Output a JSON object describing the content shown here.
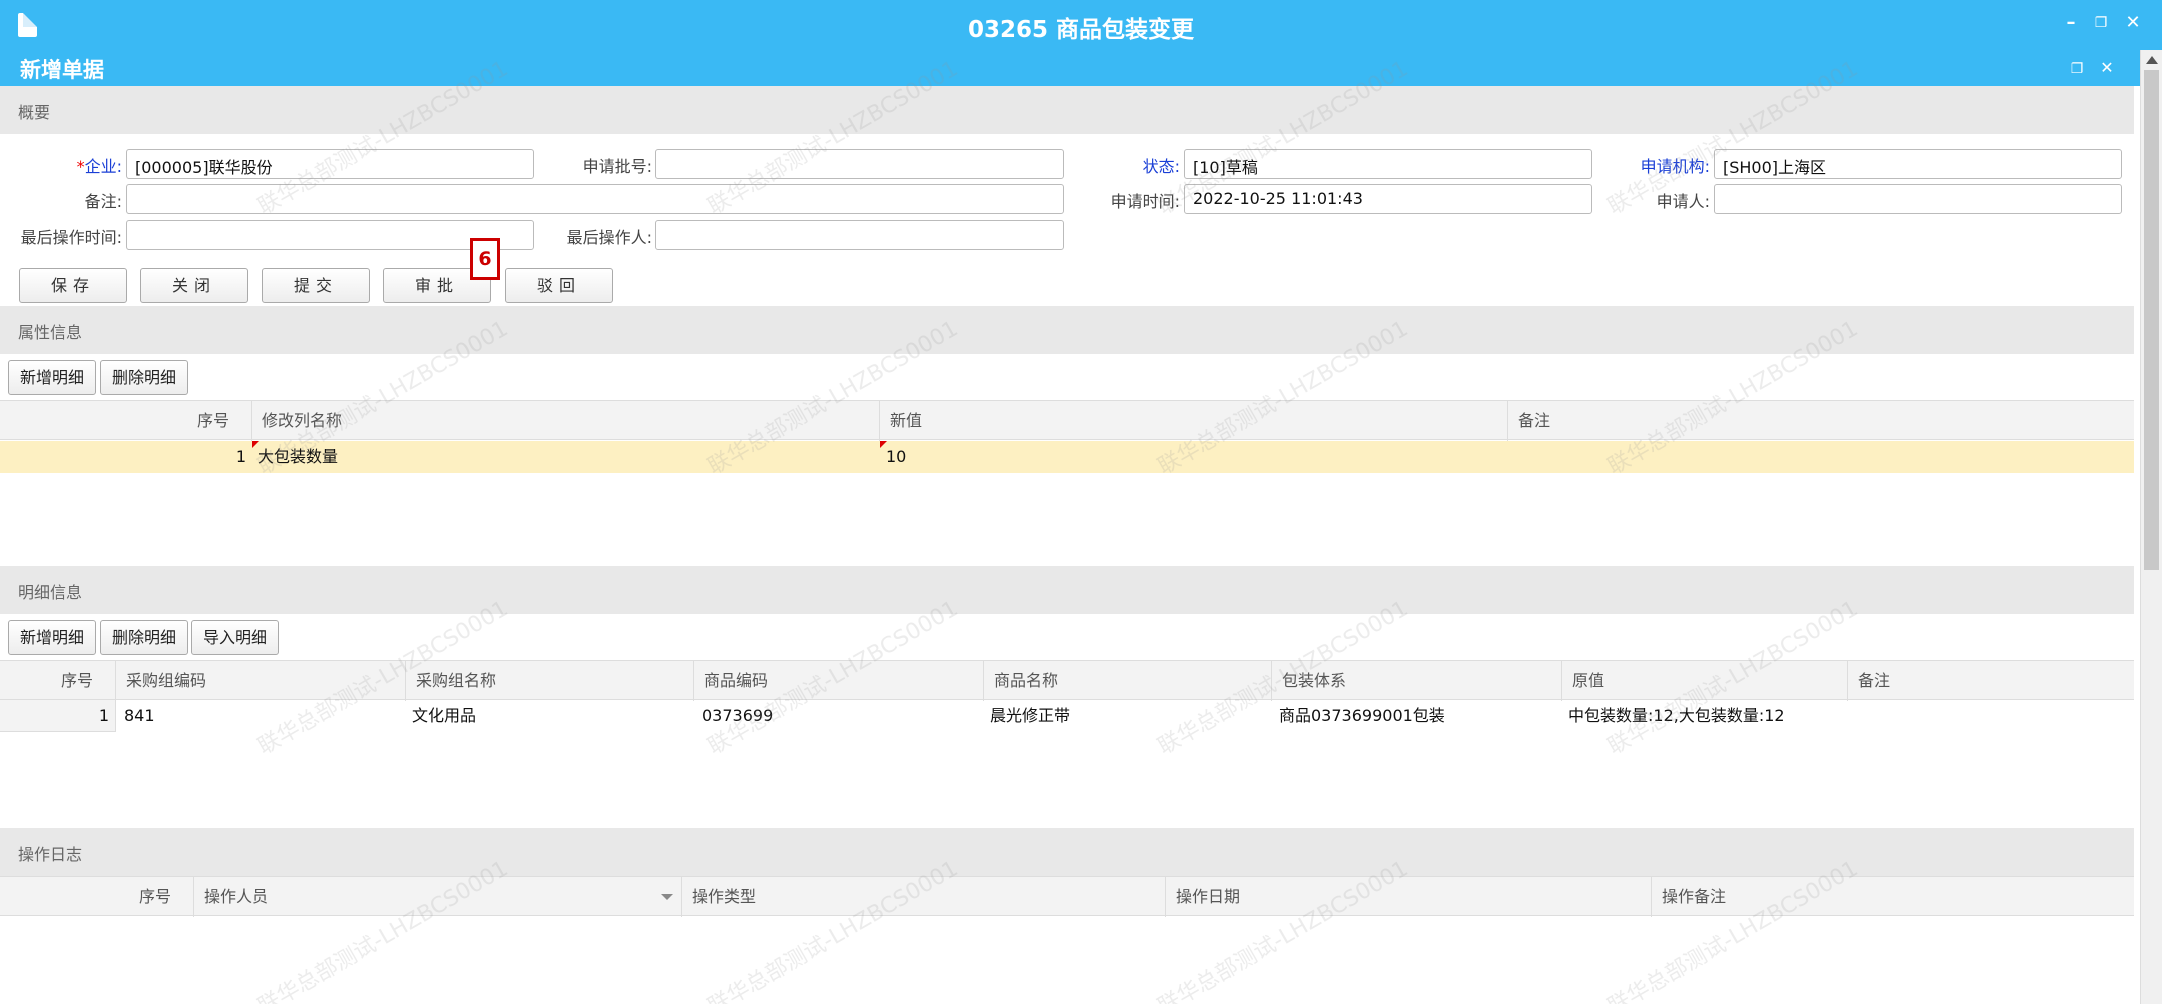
{
  "window": {
    "title": "03265 商品包装变更"
  },
  "subwindow": {
    "title": "新增单据"
  },
  "sections": {
    "summary": "概要",
    "attributes": "属性信息",
    "details": "明细信息",
    "log": "操作日志"
  },
  "form": {
    "company_label": "企业:",
    "company_required": "*",
    "company_value": "[000005]联华股份",
    "batch_label": "申请批号:",
    "batch_value": "",
    "status_label": "状态:",
    "status_value": "[10]草稿",
    "org_label": "申请机构:",
    "org_value": "[SH00]上海区",
    "remark_label": "备注:",
    "remark_value": "",
    "apply_time_label": "申请时间:",
    "apply_time_value": "2022-10-25 11:01:43",
    "applicant_label": "申请人:",
    "applicant_value": "",
    "last_op_time_label": "最后操作时间:",
    "last_op_time_value": "",
    "last_operator_label": "最后操作人:",
    "last_operator_value": ""
  },
  "actions": {
    "save": "保存",
    "close": "关闭",
    "submit": "提交",
    "approve": "审批",
    "reject": "驳回"
  },
  "annotation": {
    "step": "6",
    "color": "#cc0000"
  },
  "attr_toolbar": {
    "add": "新增明细",
    "delete": "删除明细"
  },
  "attr_grid": {
    "headers": [
      "序号",
      "修改列名称",
      "新值",
      "备注"
    ],
    "rows": [
      {
        "seq": "1",
        "column": "大包装数量",
        "value": "10",
        "remark": ""
      }
    ]
  },
  "detail_toolbar": {
    "add": "新增明细",
    "delete": "删除明细",
    "import": "导入明细"
  },
  "detail_grid": {
    "headers": [
      "序号",
      "采购组编码",
      "采购组名称",
      "商品编码",
      "商品名称",
      "包装体系",
      "原值",
      "备注"
    ],
    "rows": [
      {
        "seq": "1",
        "group_code": "841",
        "group_name": "文化用品",
        "item_code": "0373699",
        "item_name": "晨光修正带",
        "package": "商品0373699001包装",
        "original": "中包装数量:12,大包装数量:12",
        "remark": ""
      }
    ]
  },
  "log_grid": {
    "headers": [
      "序号",
      "操作人员",
      "操作类型",
      "操作日期",
      "操作备注"
    ]
  },
  "watermark_text": "联华总部测试-LHZBCS0001",
  "colors": {
    "title_bar": "#3ab9f4",
    "selected_row": "#fdf0c2",
    "label_blue": "#1a3fd6"
  }
}
